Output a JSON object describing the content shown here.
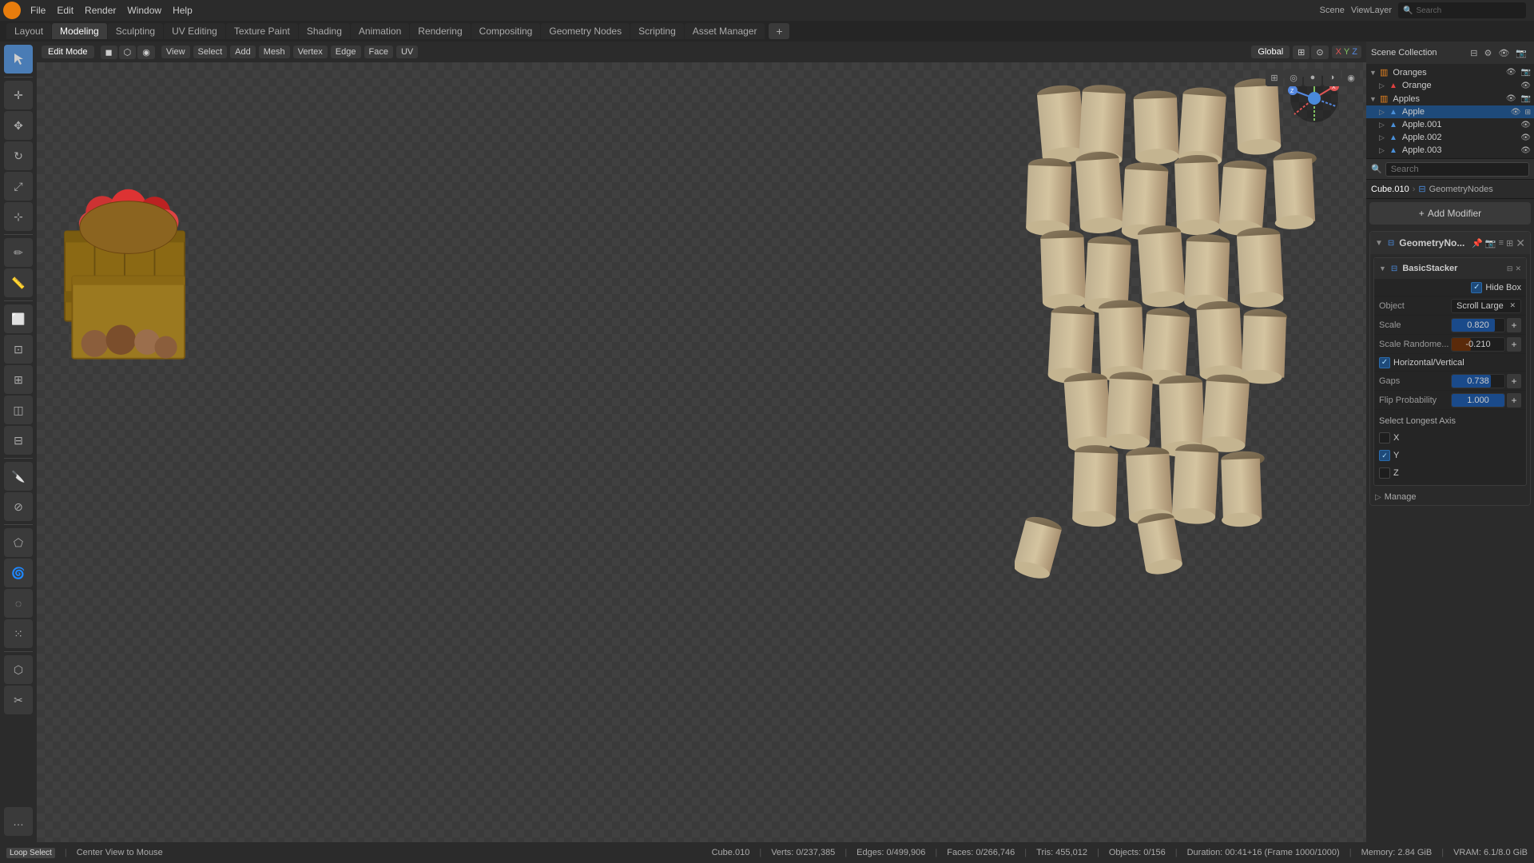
{
  "app": {
    "title": "Blender",
    "scene": "Scene",
    "view_layer": "ViewLayer"
  },
  "top_menu": {
    "items": [
      "File",
      "Edit",
      "Render",
      "Window",
      "Help"
    ]
  },
  "workspace_tabs": {
    "tabs": [
      "Layout",
      "Modeling",
      "Sculpting",
      "UV Editing",
      "Texture Paint",
      "Shading",
      "Animation",
      "Rendering",
      "Compositing",
      "Geometry Nodes",
      "Scripting",
      "Asset Manager"
    ],
    "active": "Modeling"
  },
  "viewport_header": {
    "mode": "Edit Mode",
    "view": "View",
    "select": "Select",
    "add": "Add",
    "mesh": "Mesh",
    "vertex": "Vertex",
    "edge": "Edge",
    "face": "Face",
    "uv": "UV",
    "global": "Global"
  },
  "outliner": {
    "title": "Scene Collection",
    "collections": [
      {
        "name": "Oranges",
        "expanded": true,
        "children": [
          {
            "name": "Orange",
            "icon": "mesh",
            "visible": true
          }
        ]
      },
      {
        "name": "Apples",
        "expanded": true,
        "children": [
          {
            "name": "Apple",
            "icon": "mesh",
            "visible": true,
            "selected": true
          },
          {
            "name": "Apple.001",
            "icon": "mesh",
            "visible": true
          },
          {
            "name": "Apple.002",
            "icon": "mesh",
            "visible": true
          },
          {
            "name": "Apple.003",
            "icon": "mesh",
            "visible": true
          }
        ]
      }
    ],
    "search_placeholder": "Search"
  },
  "properties": {
    "breadcrumb": [
      "Cube.010",
      "GeometryNodes"
    ],
    "add_modifier_label": "Add Modifier",
    "modifier": {
      "name": "GeometryNo...",
      "submodifier": {
        "name": "BasicStacker",
        "hide_box_label": "Hide Box",
        "hide_box_checked": true,
        "object_label": "Object",
        "object_value": "Scroll Large",
        "scale_label": "Scale",
        "scale_value": "0.820",
        "scale_random_label": "Scale Randome...",
        "scale_random_value": "-0.210",
        "h_v_label": "Horizontal/Vertical",
        "h_v_checked": true,
        "gaps_label": "Gaps",
        "gaps_value": "0.738",
        "gaps_fill_pct": 73.8,
        "flip_prob_label": "Flip Probability",
        "flip_prob_value": "1.000",
        "flip_prob_fill_pct": 100,
        "longest_axis_label": "Select Longest Axis",
        "axis_x_label": "X",
        "axis_x_checked": false,
        "axis_y_label": "Y",
        "axis_y_checked": true,
        "axis_z_label": "Z",
        "axis_z_checked": false,
        "manage_label": "Manage"
      }
    },
    "search_placeholder": "Search"
  },
  "status_bar": {
    "mode": "Loop Select",
    "hint": "Center View to Mouse",
    "object_info": "Cube.010",
    "verts": "Verts: 0/237,385",
    "edges": "Edges: 0/499,906",
    "faces": "Faces: 0/266,746",
    "tris": "Tris: 455,012",
    "objects": "Objects: 0/156",
    "duration": "Duration: 00:41+16 (Frame 1000/1000)",
    "memory": "Memory: 2.84 GiB",
    "vram": "VRAM: 6.1/8.0 GiB"
  }
}
